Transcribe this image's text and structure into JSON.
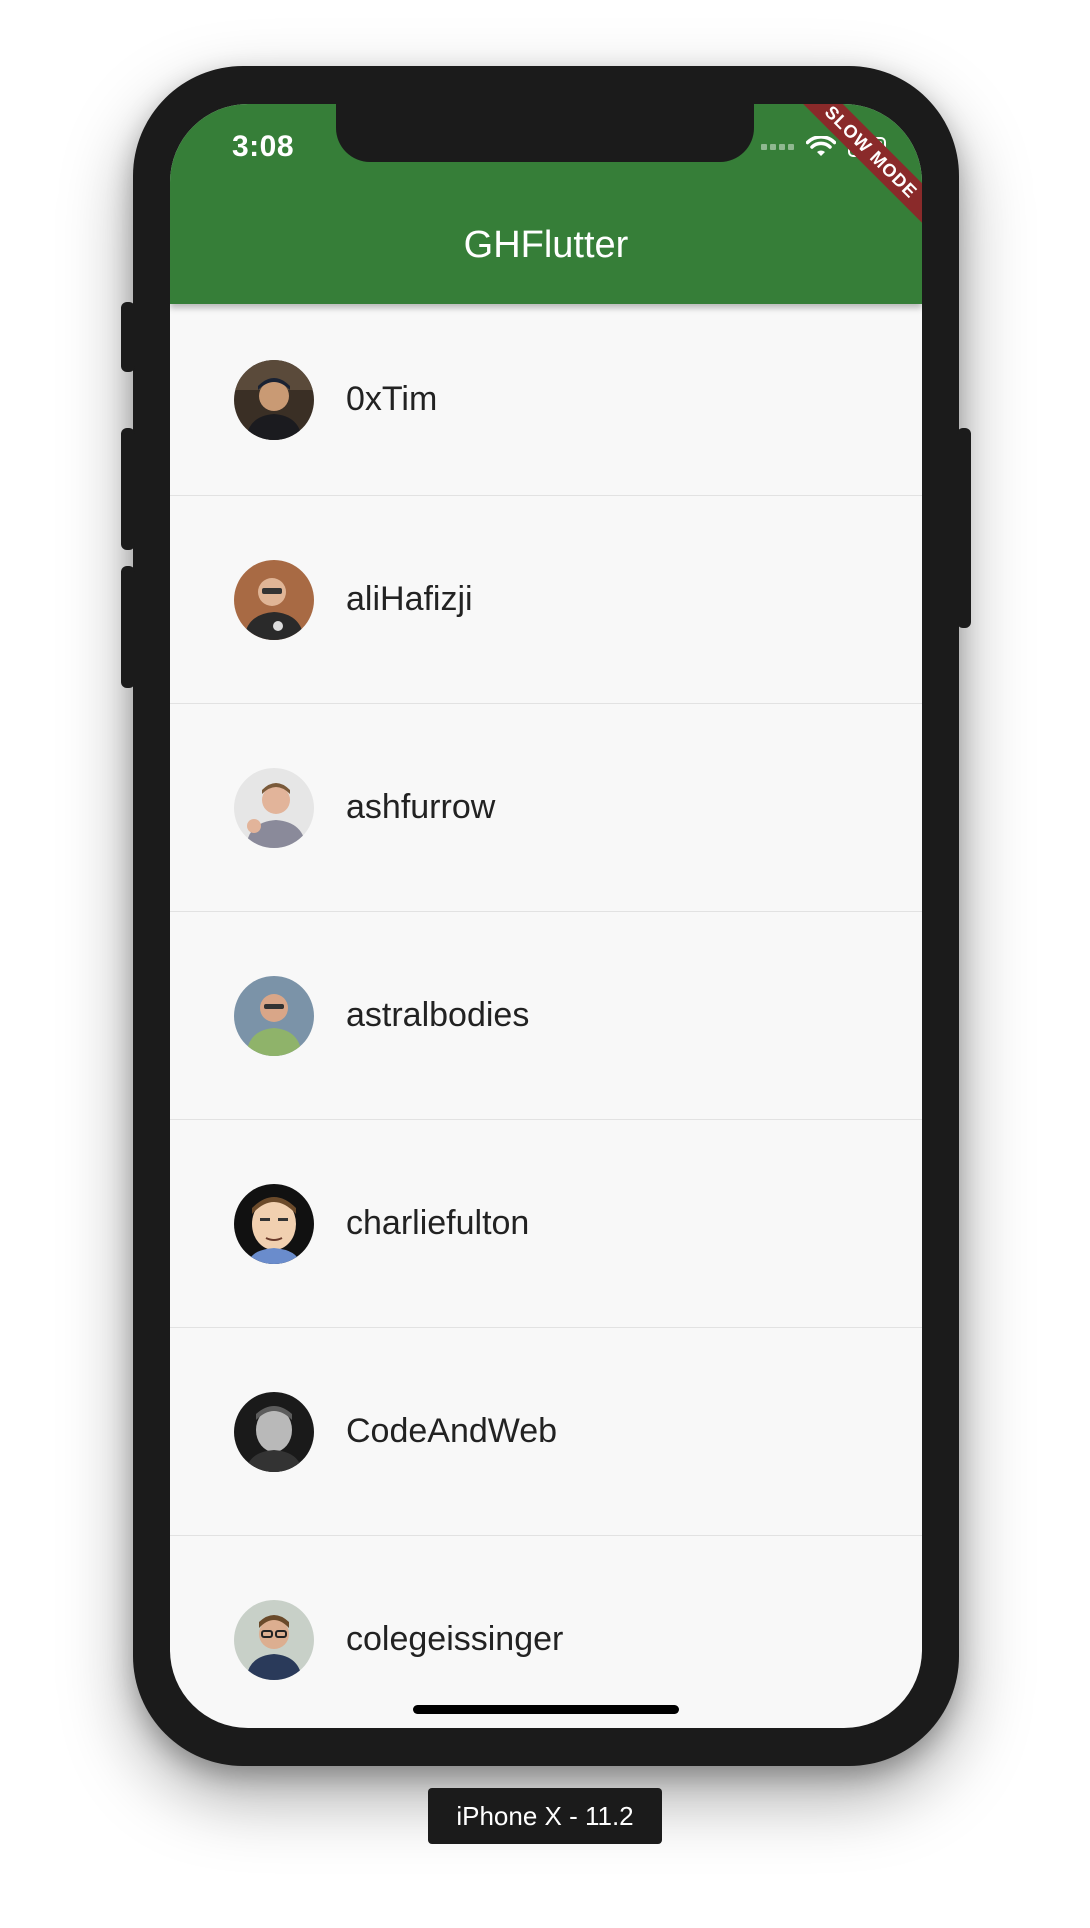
{
  "status_bar": {
    "time": "3:08"
  },
  "app_bar": {
    "title": "GHFlutter",
    "color": "#367e38"
  },
  "debug_banner": {
    "label": "SLOW MODE",
    "color": "#8a2a2a"
  },
  "members": [
    {
      "login": "0xTim",
      "avatar_icon": "avatar-photo"
    },
    {
      "login": "aliHafizji",
      "avatar_icon": "avatar-photo"
    },
    {
      "login": "ashfurrow",
      "avatar_icon": "avatar-photo"
    },
    {
      "login": "astralbodies",
      "avatar_icon": "avatar-photo"
    },
    {
      "login": "charliefulton",
      "avatar_icon": "avatar-cartoon"
    },
    {
      "login": "CodeAndWeb",
      "avatar_icon": "avatar-photo"
    },
    {
      "login": "colegeissinger",
      "avatar_icon": "avatar-photo"
    }
  ],
  "device_label": "iPhone X - 11.2"
}
